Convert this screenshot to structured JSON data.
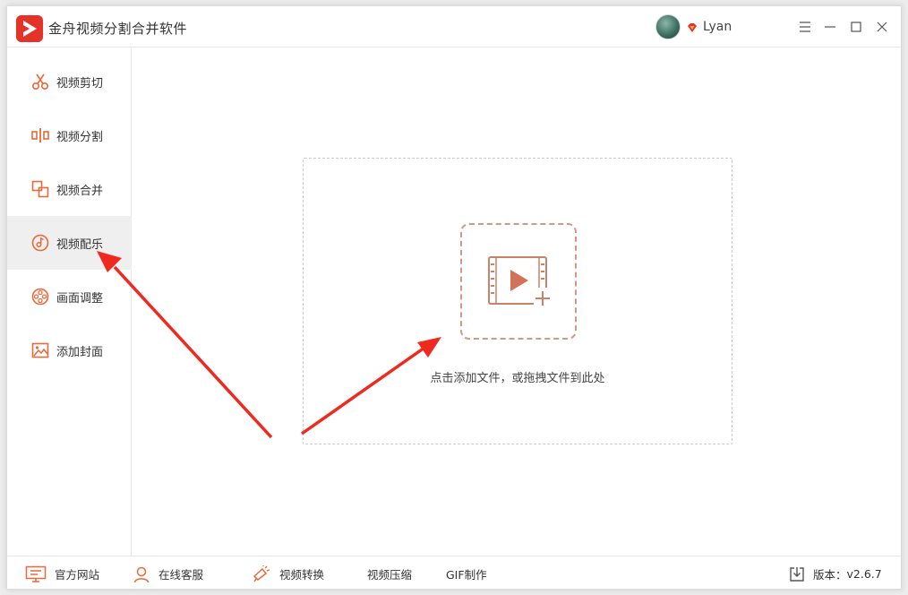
{
  "app": {
    "title": "金舟视频分割合并软件"
  },
  "user": {
    "name": "Lyan"
  },
  "sidebar": {
    "items": [
      {
        "label": "视频剪切",
        "icon": "scissors-icon"
      },
      {
        "label": "视频分割",
        "icon": "split-icon"
      },
      {
        "label": "视频合并",
        "icon": "merge-icon"
      },
      {
        "label": "视频配乐",
        "icon": "music-note-icon",
        "active": true
      },
      {
        "label": "画面调整",
        "icon": "film-reel-icon"
      },
      {
        "label": "添加封面",
        "icon": "image-icon"
      }
    ]
  },
  "main": {
    "drop_text": "点击添加文件，或拖拽文件到此处"
  },
  "statusbar": {
    "website": "官方网站",
    "support": "在线客服",
    "convert": "视频转换",
    "compress": "视频压缩",
    "gif": "GIF制作",
    "version_label": "版本：",
    "version": "v2.6.7"
  },
  "colors": {
    "accent": "#e8693a",
    "brand_red": "#e5332a",
    "active_bg": "#efefef",
    "annotation": "#f0291f"
  }
}
